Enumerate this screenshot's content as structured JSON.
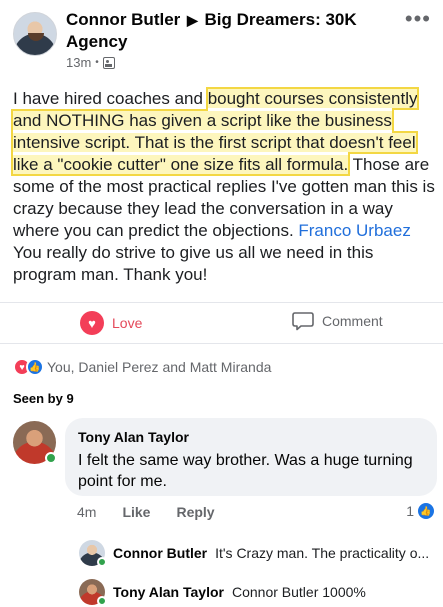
{
  "post": {
    "author": "Connor Butler",
    "group": "Big Dreamers:  30K Agency",
    "time": "13m",
    "dot": "•",
    "more_icon": "•••",
    "body_start": "I have hired coaches and ",
    "body_highlight": "bought courses consistently and NOTHING has given a script like the business intensive script. That is the first script that doesn't feel like a \"cookie cutter\" one size fits all formula.",
    "body_middle": " Those are some of the most practical replies I've gotten man this is crazy because they lead the conversation in a way where you can predict the objections. ",
    "body_mention": "Franco Urbaez",
    "body_end": " You really do strive to give us all we need in this program man. Thank you!"
  },
  "actions": {
    "love_label": "Love",
    "comment_label": "Comment"
  },
  "reactions": {
    "names": "You, Daniel Perez and Matt Miranda",
    "seen_by": "Seen by 9"
  },
  "comment": {
    "author": "Tony Alan Taylor",
    "text": "I felt the same way brother. Was a huge turning point for me.",
    "time": "4m",
    "like_label": "Like",
    "reply_label": "Reply",
    "like_count": "1"
  },
  "replies": [
    {
      "author": "Connor Butler",
      "text": "It's Crazy man. The practicality o..."
    },
    {
      "author": "Tony Alan Taylor",
      "text": "Connor Butler 1000%"
    }
  ],
  "colors": {
    "highlight": "#fdf6bd",
    "highlight_border": "#f3d743",
    "mention": "#216fdb",
    "love": "#f33e58",
    "like": "#1b74e4",
    "online": "#31a24c"
  }
}
